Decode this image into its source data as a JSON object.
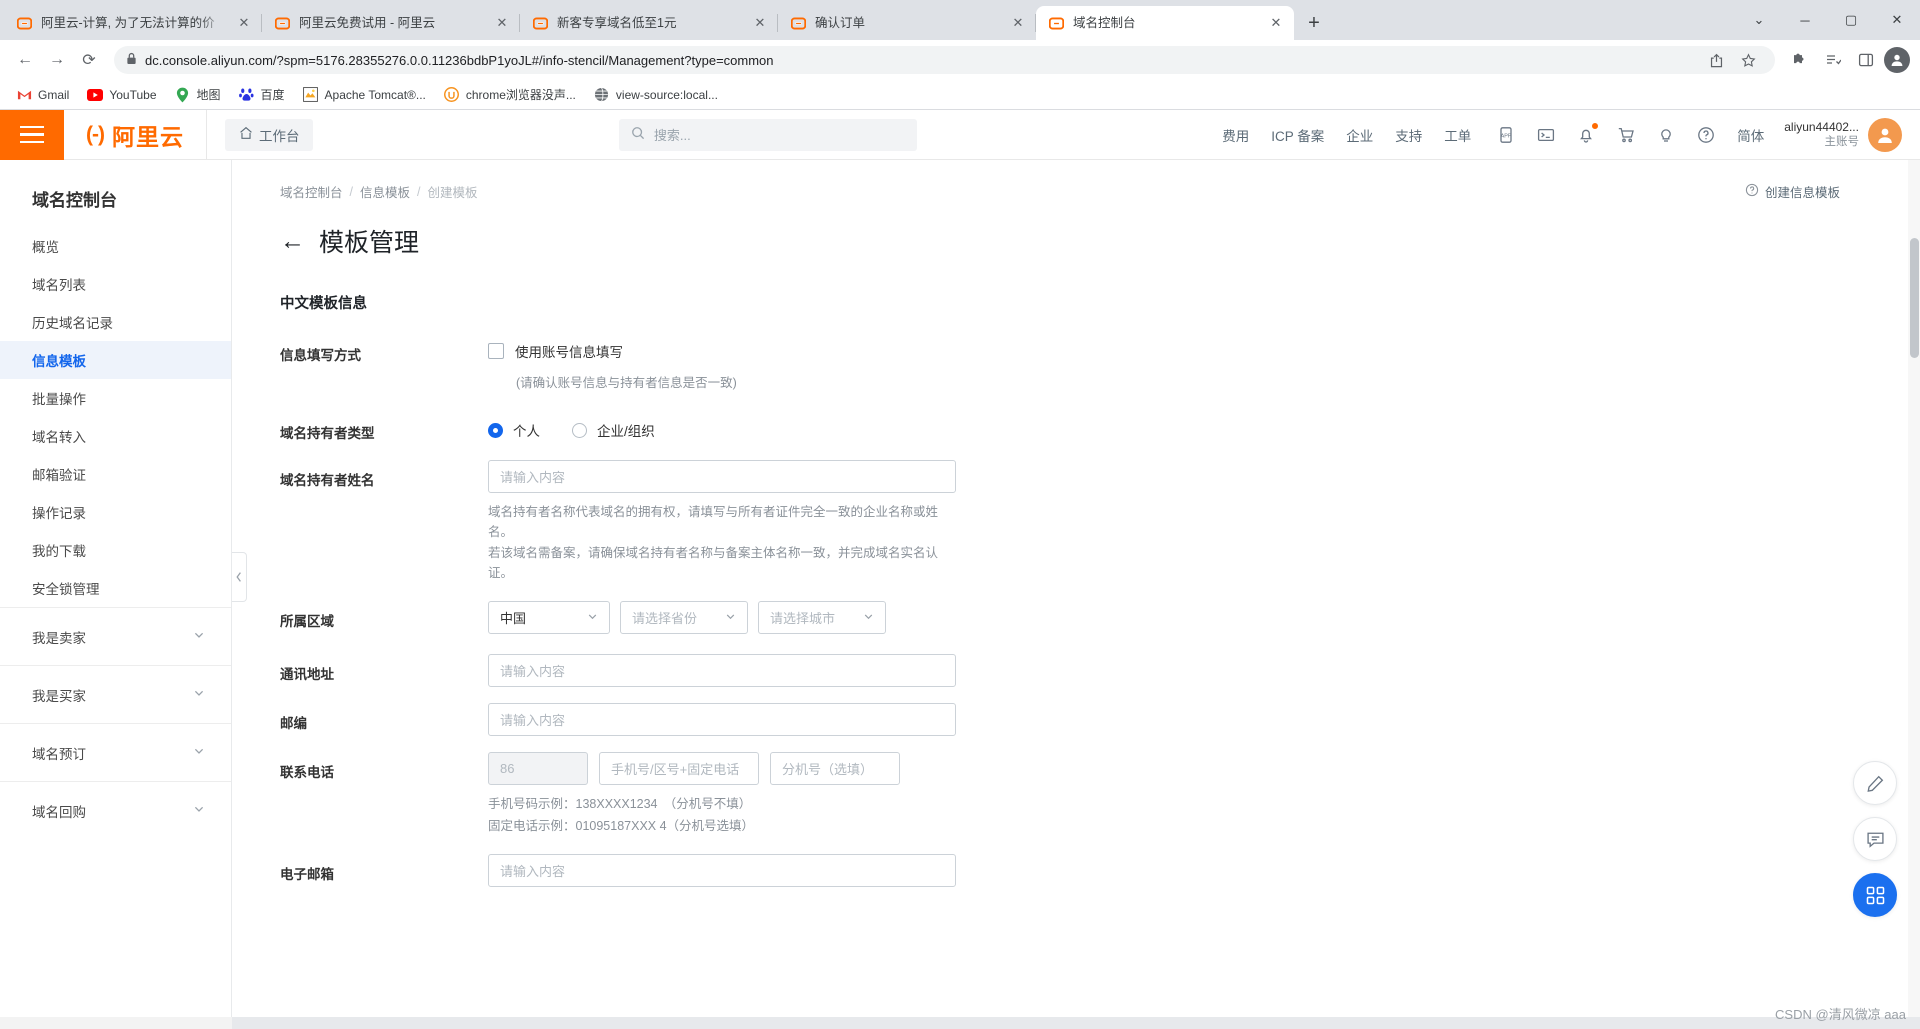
{
  "browser": {
    "tabs": [
      {
        "title": "阿里云-计算, 为了无法计算的价",
        "favicon": "aliyun-icon",
        "active": false
      },
      {
        "title": "阿里云免费试用 - 阿里云",
        "favicon": "aliyun-icon",
        "active": false
      },
      {
        "title": "新客专享域名低至1元",
        "favicon": "aliyun-icon",
        "active": false
      },
      {
        "title": "确认订单",
        "favicon": "aliyun-icon",
        "active": false
      },
      {
        "title": "域名控制台",
        "favicon": "aliyun-icon",
        "active": true
      }
    ],
    "tab_close_label": "✕",
    "new_tab_label": "+",
    "window": {
      "minimize": "─",
      "maximize": "▢",
      "close": "✕",
      "more": "⌄"
    },
    "nav": {
      "back": "←",
      "forward": "→",
      "reload": "⟳"
    },
    "omnibox": {
      "lock_icon": "lock-icon",
      "url": "dc.console.aliyun.com/?spm=5176.28355276.0.0.11236bdbP1yoJL#/info-stencil/Management?type=common",
      "share_icon": "share-icon",
      "bookmark_icon": "star-icon"
    },
    "toolbar_right": {
      "extensions": "puzzle-icon",
      "reading_list": "reading-list-icon",
      "side_panel": "side-panel-icon",
      "profile": "profile-avatar-icon"
    },
    "bookmarks": [
      {
        "label": "Gmail",
        "icon": "gmail-icon"
      },
      {
        "label": "YouTube",
        "icon": "youtube-icon"
      },
      {
        "label": "地图",
        "icon": "maps-icon"
      },
      {
        "label": "百度",
        "icon": "baidu-icon"
      },
      {
        "label": "Apache Tomcat®...",
        "icon": "tomcat-icon"
      },
      {
        "label": "chrome浏览器没声...",
        "icon": "orange-circle-icon"
      },
      {
        "label": "view-source:local...",
        "icon": "globe-icon"
      }
    ]
  },
  "header": {
    "menu_icon": "hamburger-icon",
    "logo_text": "阿里云",
    "logo_mark": "(-)",
    "workbench": "工作台",
    "home_icon": "home-icon",
    "search_placeholder": "搜索...",
    "search_icon": "search-icon",
    "nav": [
      "费用",
      "ICP 备案",
      "企业",
      "支持",
      "工单"
    ],
    "icons": [
      "app-icon",
      "terminal-icon",
      "bell-icon",
      "cart-icon",
      "bulb-icon",
      "question-icon"
    ],
    "language": "简体",
    "user_name": "aliyun44402...",
    "user_role": "主账号",
    "avatar_icon": "user-avatar-icon"
  },
  "sidebar": {
    "title": "域名控制台",
    "items": [
      {
        "label": "概览",
        "active": false
      },
      {
        "label": "域名列表",
        "active": false
      },
      {
        "label": "历史域名记录",
        "active": false
      },
      {
        "label": "信息模板",
        "active": true
      },
      {
        "label": "批量操作",
        "active": false
      },
      {
        "label": "域名转入",
        "active": false
      },
      {
        "label": "邮箱验证",
        "active": false
      },
      {
        "label": "操作记录",
        "active": false
      },
      {
        "label": "我的下载",
        "active": false
      },
      {
        "label": "安全锁管理",
        "active": false
      }
    ],
    "groups": [
      {
        "label": "我是卖家",
        "chevron": "chevron-down-icon"
      },
      {
        "label": "我是买家",
        "chevron": "chevron-down-icon"
      },
      {
        "label": "域名预订",
        "chevron": "chevron-down-icon"
      },
      {
        "label": "域名回购",
        "chevron": "chevron-down-icon"
      }
    ]
  },
  "main": {
    "breadcrumb": [
      "域名控制台",
      "信息模板",
      "创建模板"
    ],
    "breadcrumb_sep": "/",
    "back_arrow": "←",
    "page_title": "模板管理",
    "help_link": "创建信息模板",
    "help_icon": "question-circle-icon",
    "section_title": "中文模板信息",
    "fields": {
      "fill_method": {
        "label": "信息填写方式",
        "checkbox_label": "使用账号信息填写",
        "checked": false,
        "hint": "(请确认账号信息与持有者信息是否一致)"
      },
      "holder_type": {
        "label": "域名持有者类型",
        "options": [
          {
            "label": "个人",
            "selected": true
          },
          {
            "label": "企业/组织",
            "selected": false
          }
        ]
      },
      "holder_name": {
        "label": "域名持有者姓名",
        "placeholder": "请输入内容",
        "value": "",
        "help_line1": "域名持有者名称代表域名的拥有权，请填写与所有者证件完全一致的企业名称或姓名。",
        "help_line2": "若该域名需备案，请确保域名持有者名称与备案主体名称一致，并完成域名实名认证。"
      },
      "region": {
        "label": "所属区域",
        "country": "中国",
        "province_placeholder": "请选择省份",
        "city_placeholder": "请选择城市",
        "chevron": "chevron-down-icon"
      },
      "address": {
        "label": "通讯地址",
        "placeholder": "请输入内容",
        "value": ""
      },
      "zipcode": {
        "label": "邮编",
        "placeholder": "请输入内容",
        "value": ""
      },
      "phone": {
        "label": "联系电话",
        "country_code": "86",
        "number_placeholder": "手机号/区号+固定电话",
        "ext_placeholder": "分机号（选填）",
        "help_line1": "手机号码示例：138XXXX1234　（分机号不填）",
        "help_line2": "固定电话示例：01095187XXX 4（分机号选填）"
      },
      "email": {
        "label": "电子邮箱",
        "placeholder": "请输入内容",
        "value": ""
      }
    },
    "float_buttons": [
      {
        "icon": "pencil-icon",
        "primary": false
      },
      {
        "icon": "chat-icon",
        "primary": false
      },
      {
        "icon": "apps-grid-icon",
        "primary": true
      }
    ],
    "collapse_handle_icon": "chevron-left-icon"
  },
  "watermark": "CSDN @清风微凉 aaa"
}
